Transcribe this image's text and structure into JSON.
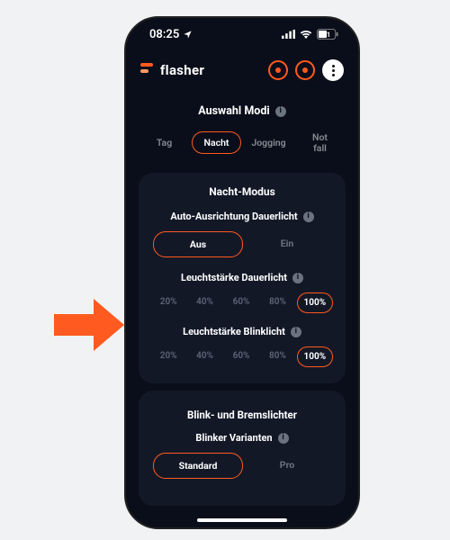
{
  "colors": {
    "accent": "#ff5a1f",
    "bg": "#0a0e1a",
    "card": "#131827",
    "muted": "#6b7280"
  },
  "status": {
    "time": "08:25",
    "battery": "51"
  },
  "brand": {
    "name": "flasher"
  },
  "modes": {
    "title": "Auswahl Modi",
    "items": [
      {
        "label": "Tag",
        "selected": false
      },
      {
        "label": "Nacht",
        "selected": true
      },
      {
        "label": "Jogging",
        "selected": false
      },
      {
        "label": "Not\nfall",
        "selected": false
      }
    ]
  },
  "night": {
    "title": "Nacht-Modus",
    "auto": {
      "title": "Auto-Ausrichtung Dauerlicht",
      "options": [
        {
          "label": "Aus",
          "selected": true
        },
        {
          "label": "Ein",
          "selected": false
        }
      ]
    },
    "constant": {
      "title": "Leuchtstärke Dauerlicht",
      "options": [
        {
          "label": "20%",
          "selected": false
        },
        {
          "label": "40%",
          "selected": false
        },
        {
          "label": "60%",
          "selected": false
        },
        {
          "label": "80%",
          "selected": false
        },
        {
          "label": "100%",
          "selected": true
        }
      ]
    },
    "blink": {
      "title": "Leuchtstärke Blinklicht",
      "options": [
        {
          "label": "20%",
          "selected": false
        },
        {
          "label": "40%",
          "selected": false
        },
        {
          "label": "60%",
          "selected": false
        },
        {
          "label": "80%",
          "selected": false
        },
        {
          "label": "100%",
          "selected": true
        }
      ]
    }
  },
  "brake": {
    "title": "Blink- und Bremslichter",
    "variants": {
      "title": "Blinker Varianten",
      "options": [
        {
          "label": "Standard",
          "selected": true
        },
        {
          "label": "Pro",
          "selected": false
        }
      ]
    }
  }
}
